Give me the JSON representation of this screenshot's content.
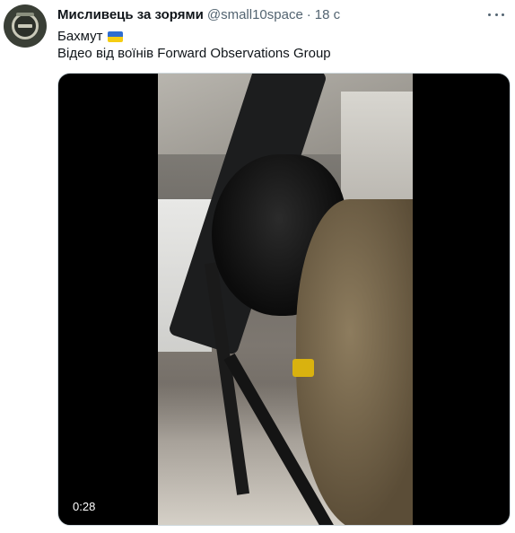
{
  "author": {
    "display_name": "Мисливець за зорями",
    "handle": "@small10space",
    "separator": "·",
    "timestamp": "18 с",
    "avatar_icon": "shield-emblem-avatar"
  },
  "tweet": {
    "line1": "Бахмут",
    "line1_emoji": "ukraine-flag-icon",
    "line2": "Відео від воїнів Forward Observations Group"
  },
  "media": {
    "type": "video",
    "duration": "0:28"
  },
  "colors": {
    "text_primary": "#0f1419",
    "text_secondary": "#536471",
    "flag_blue": "#2f6dd0",
    "flag_yellow": "#f5cd12"
  }
}
